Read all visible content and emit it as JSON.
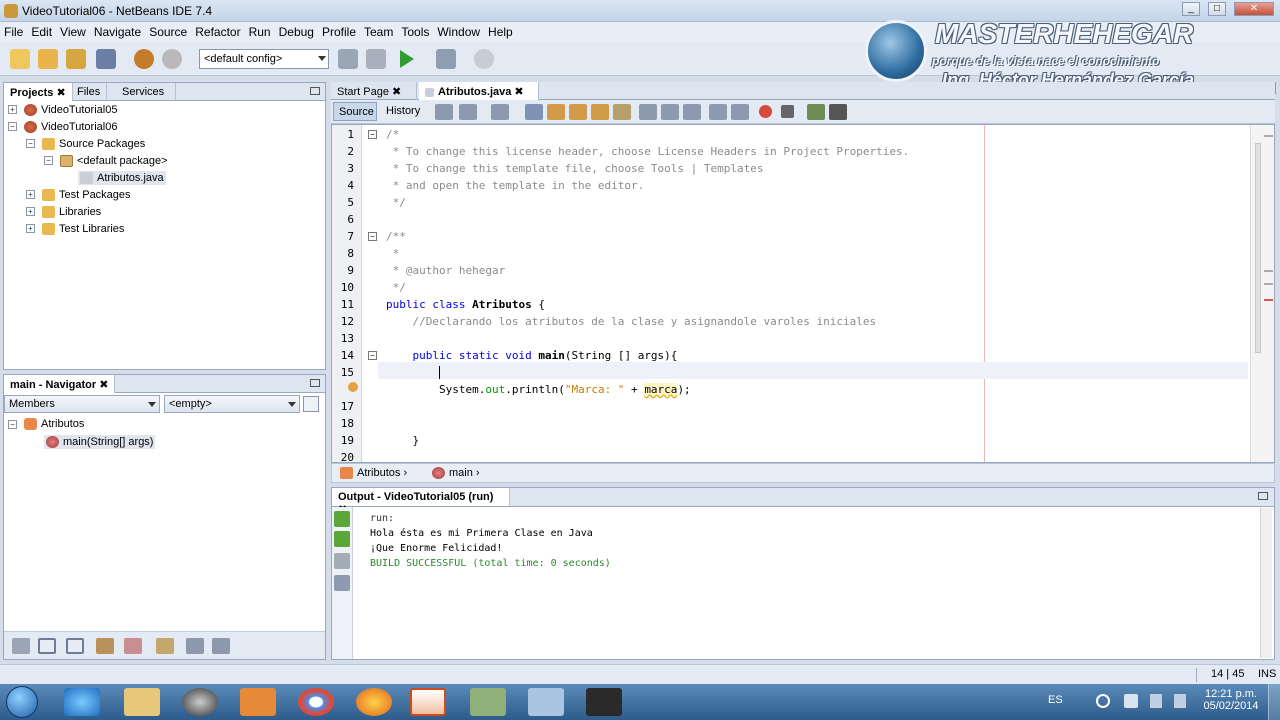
{
  "window": {
    "title": "VideoTutorial06 - NetBeans IDE 7.4"
  },
  "menu": [
    "File",
    "Edit",
    "View",
    "Navigate",
    "Source",
    "Refactor",
    "Run",
    "Debug",
    "Profile",
    "Team",
    "Tools",
    "Window",
    "Help"
  ],
  "toolbar": {
    "config_value": "<default config>"
  },
  "watermark": {
    "line1": "MASTERHEHEGAR",
    "line2": "porque de la vista nace el conocimiento",
    "line3": "Ing. Héctor Hernández García"
  },
  "projects_panel": {
    "tabs": [
      "Projects",
      "Files",
      "Services"
    ],
    "tree": [
      {
        "label": "VideoTutorial05"
      },
      {
        "label": "VideoTutorial06"
      },
      {
        "label": "Source Packages"
      },
      {
        "label": "<default package>"
      },
      {
        "label": "Atributos.java"
      },
      {
        "label": "Test Packages"
      },
      {
        "label": "Libraries"
      },
      {
        "label": "Test Libraries"
      }
    ]
  },
  "navigator": {
    "title": "main - Navigator",
    "members_label": "Members",
    "filter_value": "<empty>",
    "tree": [
      {
        "label": "Atributos"
      },
      {
        "label": "main(String[] args)"
      }
    ]
  },
  "editor": {
    "tabs": [
      "Start Page",
      "Atributos.java"
    ],
    "subtabs": [
      "Source",
      "History"
    ],
    "line_numbers": [
      "1",
      "2",
      "3",
      "4",
      "5",
      "6",
      "7",
      "8",
      "9",
      "10",
      "11",
      "12",
      "13",
      "14",
      "15",
      "",
      "17",
      "18",
      "19",
      "20"
    ],
    "breadcrumb": [
      "Atributos",
      "main"
    ]
  },
  "output": {
    "title": "Output - VideoTutorial05 (run)",
    "lines": [
      "run:",
      "Hola ésta es mi Primera Clase en Java",
      "¡Que Enorme Felicidad!",
      "BUILD SUCCESSFUL (total time: 0 seconds)"
    ]
  },
  "status": {
    "position": "14 | 45",
    "mode": "INS"
  },
  "taskbar": {
    "lang": "ES",
    "time": "12:21 p.m.",
    "date": "05/02/2014"
  }
}
